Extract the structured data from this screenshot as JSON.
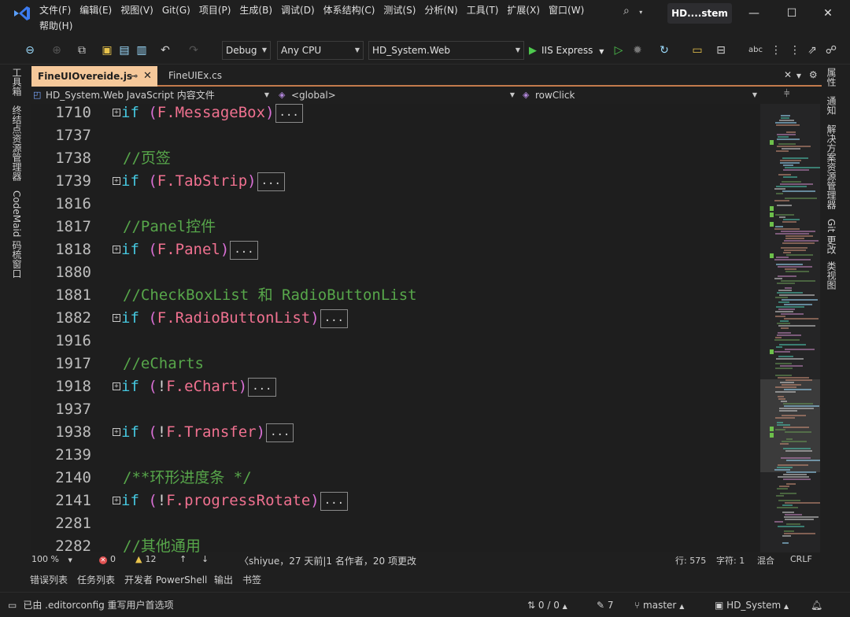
{
  "menu": [
    "文件(F)",
    "编辑(E)",
    "视图(V)",
    "Git(G)",
    "项目(P)",
    "生成(B)",
    "调试(D)",
    "体系结构(C)",
    "测试(S)",
    "分析(N)",
    "工具(T)",
    "扩展(X)",
    "窗口(W)",
    "帮助(H)"
  ],
  "solution_title": "HD....stem",
  "toolbar": {
    "config": "Debug",
    "platform": "Any CPU",
    "startup_project": "HD_System.Web",
    "run_label": "IIS Express"
  },
  "left_rail": [
    "工具箱",
    "终结点资源管理器",
    "CodeMaid 码梳窗口"
  ],
  "right_rail": [
    "属性",
    "通知",
    "解决方案资源管理器",
    "Git 更改",
    "类视图"
  ],
  "tabs": {
    "active": "FineUIOvereide.js",
    "other": "FineUIEx.cs"
  },
  "navbar": {
    "project": "HD_System.Web JavaScript 内容文件",
    "scope": "<global>",
    "member": "rowClick"
  },
  "code_lines": [
    {
      "ln": "1710",
      "fold": true,
      "kw": "if",
      "open": " (",
      "neg": "",
      "obj": "F.MessageBox",
      "close": ")",
      "comment": ""
    },
    {
      "ln": "1737",
      "fold": false,
      "kw": "",
      "open": "",
      "neg": "",
      "obj": "",
      "close": "",
      "comment": ""
    },
    {
      "ln": "1738",
      "fold": false,
      "kw": "",
      "open": "",
      "neg": "",
      "obj": "",
      "close": "",
      "comment": "//页签"
    },
    {
      "ln": "1739",
      "fold": true,
      "kw": "if",
      "open": " (",
      "neg": "",
      "obj": "F.TabStrip",
      "close": ")",
      "comment": ""
    },
    {
      "ln": "1816",
      "fold": false,
      "kw": "",
      "open": "",
      "neg": "",
      "obj": "",
      "close": "",
      "comment": ""
    },
    {
      "ln": "1817",
      "fold": false,
      "kw": "",
      "open": "",
      "neg": "",
      "obj": "",
      "close": "",
      "comment": "//Panel控件"
    },
    {
      "ln": "1818",
      "fold": true,
      "kw": "if",
      "open": " (",
      "neg": "",
      "obj": "F.Panel",
      "close": ")",
      "comment": ""
    },
    {
      "ln": "1880",
      "fold": false,
      "kw": "",
      "open": "",
      "neg": "",
      "obj": "",
      "close": "",
      "comment": ""
    },
    {
      "ln": "1881",
      "fold": false,
      "kw": "",
      "open": "",
      "neg": "",
      "obj": "",
      "close": "",
      "comment": "//CheckBoxList 和 RadioButtonList"
    },
    {
      "ln": "1882",
      "fold": true,
      "kw": "if",
      "open": " (",
      "neg": "",
      "obj": "F.RadioButtonList",
      "close": ")",
      "comment": ""
    },
    {
      "ln": "1916",
      "fold": false,
      "kw": "",
      "open": "",
      "neg": "",
      "obj": "",
      "close": "",
      "comment": ""
    },
    {
      "ln": "1917",
      "fold": false,
      "kw": "",
      "open": "",
      "neg": "",
      "obj": "",
      "close": "",
      "comment": "//eCharts"
    },
    {
      "ln": "1918",
      "fold": true,
      "kw": "if",
      "open": " (",
      "neg": "!",
      "obj": "F.eChart",
      "close": ")",
      "comment": ""
    },
    {
      "ln": "1937",
      "fold": false,
      "kw": "",
      "open": "",
      "neg": "",
      "obj": "",
      "close": "",
      "comment": ""
    },
    {
      "ln": "1938",
      "fold": true,
      "kw": "if",
      "open": " (",
      "neg": "!",
      "obj": "F.Transfer",
      "close": ")",
      "comment": ""
    },
    {
      "ln": "2139",
      "fold": false,
      "kw": "",
      "open": "",
      "neg": "",
      "obj": "",
      "close": "",
      "comment": ""
    },
    {
      "ln": "2140",
      "fold": false,
      "kw": "",
      "open": "",
      "neg": "",
      "obj": "",
      "close": "",
      "comment": "/**环形进度条 */"
    },
    {
      "ln": "2141",
      "fold": true,
      "kw": "if",
      "open": " (",
      "neg": "!",
      "obj": "F.progressRotate",
      "close": ")",
      "comment": ""
    },
    {
      "ln": "2281",
      "fold": false,
      "kw": "",
      "open": "",
      "neg": "",
      "obj": "",
      "close": "",
      "comment": ""
    },
    {
      "ln": "2282",
      "fold": false,
      "kw": "",
      "open": "",
      "neg": "",
      "obj": "",
      "close": "",
      "comment": "//其他通用"
    }
  ],
  "collapsed_label": "...",
  "editor_status": {
    "zoom": "100 %",
    "errors": "0",
    "warnings": "12",
    "blame": "shiyue，27 天前|1 名作者，20 项更改",
    "line": "行: 575",
    "col": "字符: 1",
    "whitespace": "混合",
    "eol": "CRLF"
  },
  "bottom_tabs": [
    "错误列表",
    "任务列表",
    "开发者 PowerShell",
    "输出",
    "书签"
  ],
  "statusbar": {
    "message": "已由 .editorconfig 重写用户首选项",
    "changes": "0 / 0",
    "pending": "7",
    "branch": "master",
    "repo": "HD_System"
  }
}
